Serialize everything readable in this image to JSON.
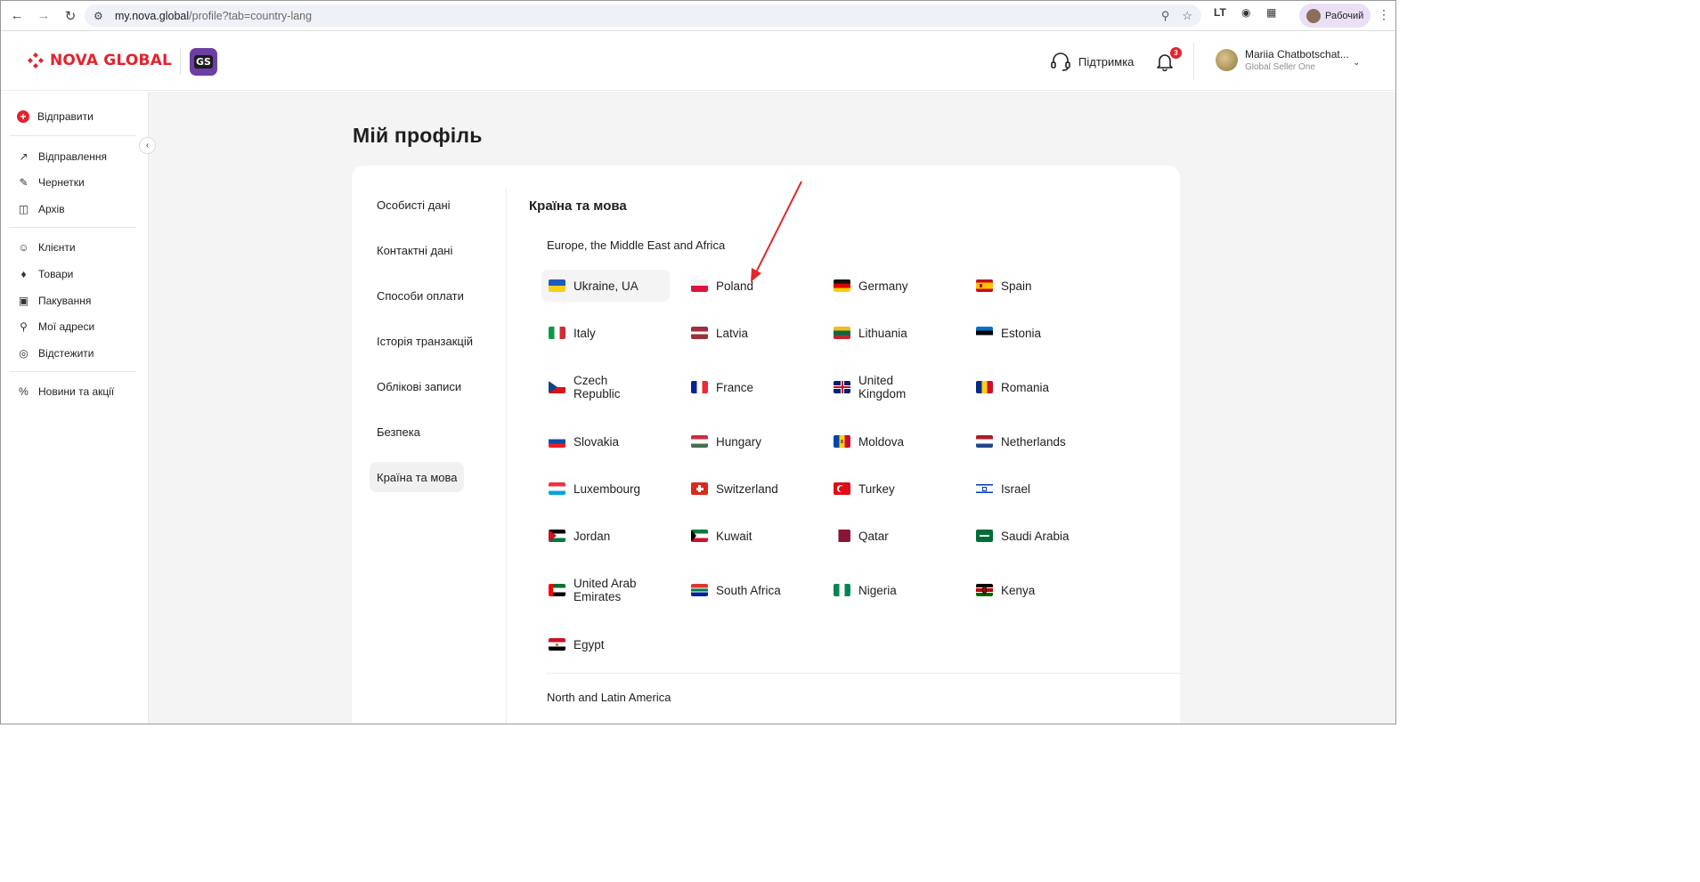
{
  "browser": {
    "url_host": "my.nova.global",
    "url_path": "/profile?tab=country-lang",
    "profile_label": "Рабочий"
  },
  "header": {
    "logo_text": "NOVA GLOBAL",
    "badge_text": "GS",
    "support_label": "Підтримка",
    "notifications_count": "3",
    "user_name": "Mariia Chatbotschat...",
    "user_role": "Global Seller One"
  },
  "sidebar": {
    "send_label": "Відправити",
    "items": [
      {
        "label": "Відправлення",
        "icon": "arrow-up-right-icon"
      },
      {
        "label": "Чернетки",
        "icon": "edit-icon"
      },
      {
        "label": "Архів",
        "icon": "archive-icon"
      },
      {
        "label": "Клієнти",
        "icon": "users-icon"
      },
      {
        "label": "Товари",
        "icon": "tag-icon"
      },
      {
        "label": "Пакування",
        "icon": "box-icon"
      },
      {
        "label": "Мої адреси",
        "icon": "address-icon"
      },
      {
        "label": "Відстежити",
        "icon": "track-icon"
      },
      {
        "label": "Новини та акції",
        "icon": "percent-icon"
      }
    ]
  },
  "page": {
    "title": "Мій профіль",
    "tabs": [
      "Особисті дані",
      "Контактні дані",
      "Способи оплати",
      "Історія транзакцій",
      "Облікові записи",
      "Безпека",
      "Країна та мова"
    ],
    "active_tab": "Країна та мова",
    "section_title": "Країна та мова",
    "regions": [
      {
        "name": "Europe, the Middle East and Africa",
        "countries": [
          {
            "name": "Ukraine, UA",
            "selected": true
          },
          {
            "name": "Poland"
          },
          {
            "name": "Germany"
          },
          {
            "name": "Spain"
          },
          {
            "name": "Italy"
          },
          {
            "name": "Latvia"
          },
          {
            "name": "Lithuania"
          },
          {
            "name": "Estonia"
          },
          {
            "name": "Czech Republic"
          },
          {
            "name": "France"
          },
          {
            "name": "United Kingdom"
          },
          {
            "name": "Romania"
          },
          {
            "name": "Slovakia"
          },
          {
            "name": "Hungary"
          },
          {
            "name": "Moldova"
          },
          {
            "name": "Netherlands"
          },
          {
            "name": "Luxembourg"
          },
          {
            "name": "Switzerland"
          },
          {
            "name": "Turkey"
          },
          {
            "name": "Israel"
          },
          {
            "name": "Jordan"
          },
          {
            "name": "Kuwait"
          },
          {
            "name": "Qatar"
          },
          {
            "name": "Saudi Arabia"
          },
          {
            "name": "United Arab Emirates"
          },
          {
            "name": "South Africa"
          },
          {
            "name": "Nigeria"
          },
          {
            "name": "Kenya"
          },
          {
            "name": "Egypt"
          }
        ]
      },
      {
        "name": "North and Latin America",
        "countries": []
      }
    ]
  },
  "colors": {
    "brand_red": "#e4232d",
    "badge_purple": "#6d3ea4",
    "annotation_arrow": "#e02a2a"
  }
}
